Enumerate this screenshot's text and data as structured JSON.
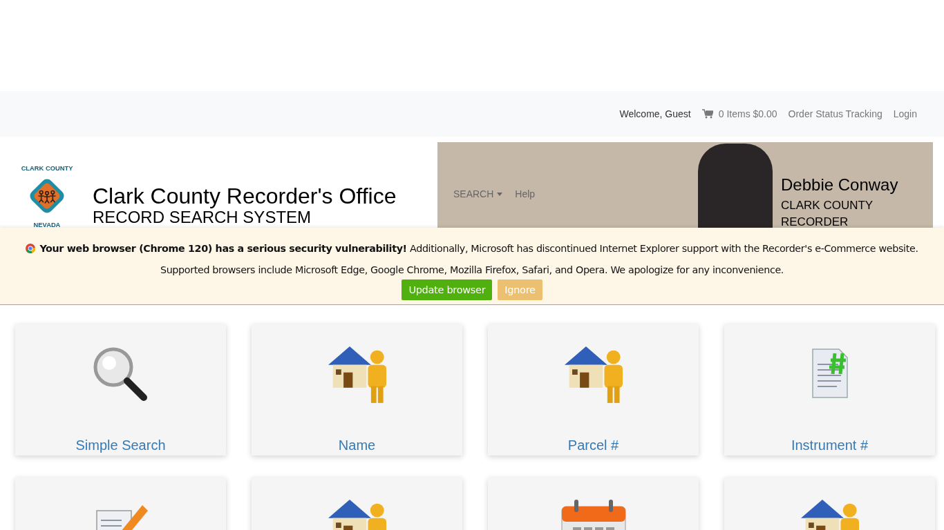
{
  "topbar": {
    "welcome": "Welcome, Guest",
    "cart": "0 Items $0.00",
    "links": [
      "Order Status Tracking",
      "Login"
    ]
  },
  "header": {
    "logo": {
      "top": "CLARK COUNTY",
      "bottom": "NEVADA"
    },
    "title": "Clark County Recorder's Office",
    "subtitle": "RECORD SEARCH SYSTEM"
  },
  "nav": [
    {
      "label": "SEARCH",
      "kind": "dropdown"
    },
    {
      "label": "Help",
      "kind": "link"
    }
  ],
  "recorder": {
    "name": "Debbie Conway",
    "role": "CLARK COUNTY RECORDER"
  },
  "banner": {
    "line1": "**Your web browser (Chrome 120) has a serious security vulnerability!** Additionally, Microsoft has discontinued Internet Explorer support with the Recorder's e-Commerce website.",
    "line2": "Supported browsers include Microsoft Edge, Google Chrome, Mozilla Firefox, Safari, and Opera. We apologize for any inconvenience.",
    "buttons": [
      {
        "label": "Update browser",
        "kind": "primary"
      },
      {
        "label": "Ignore",
        "kind": "secondary"
      }
    ]
  },
  "cards": [
    {
      "kind": "magnifier",
      "label": "Simple Search"
    },
    {
      "kind": "house-person",
      "label": "Name"
    },
    {
      "kind": "house-person",
      "label": "Parcel #"
    },
    {
      "kind": "document",
      "label": "Instrument #"
    },
    {
      "kind": "note"
    },
    {
      "kind": "house-person"
    },
    {
      "kind": "calendar"
    },
    {
      "kind": "house-person"
    }
  ]
}
